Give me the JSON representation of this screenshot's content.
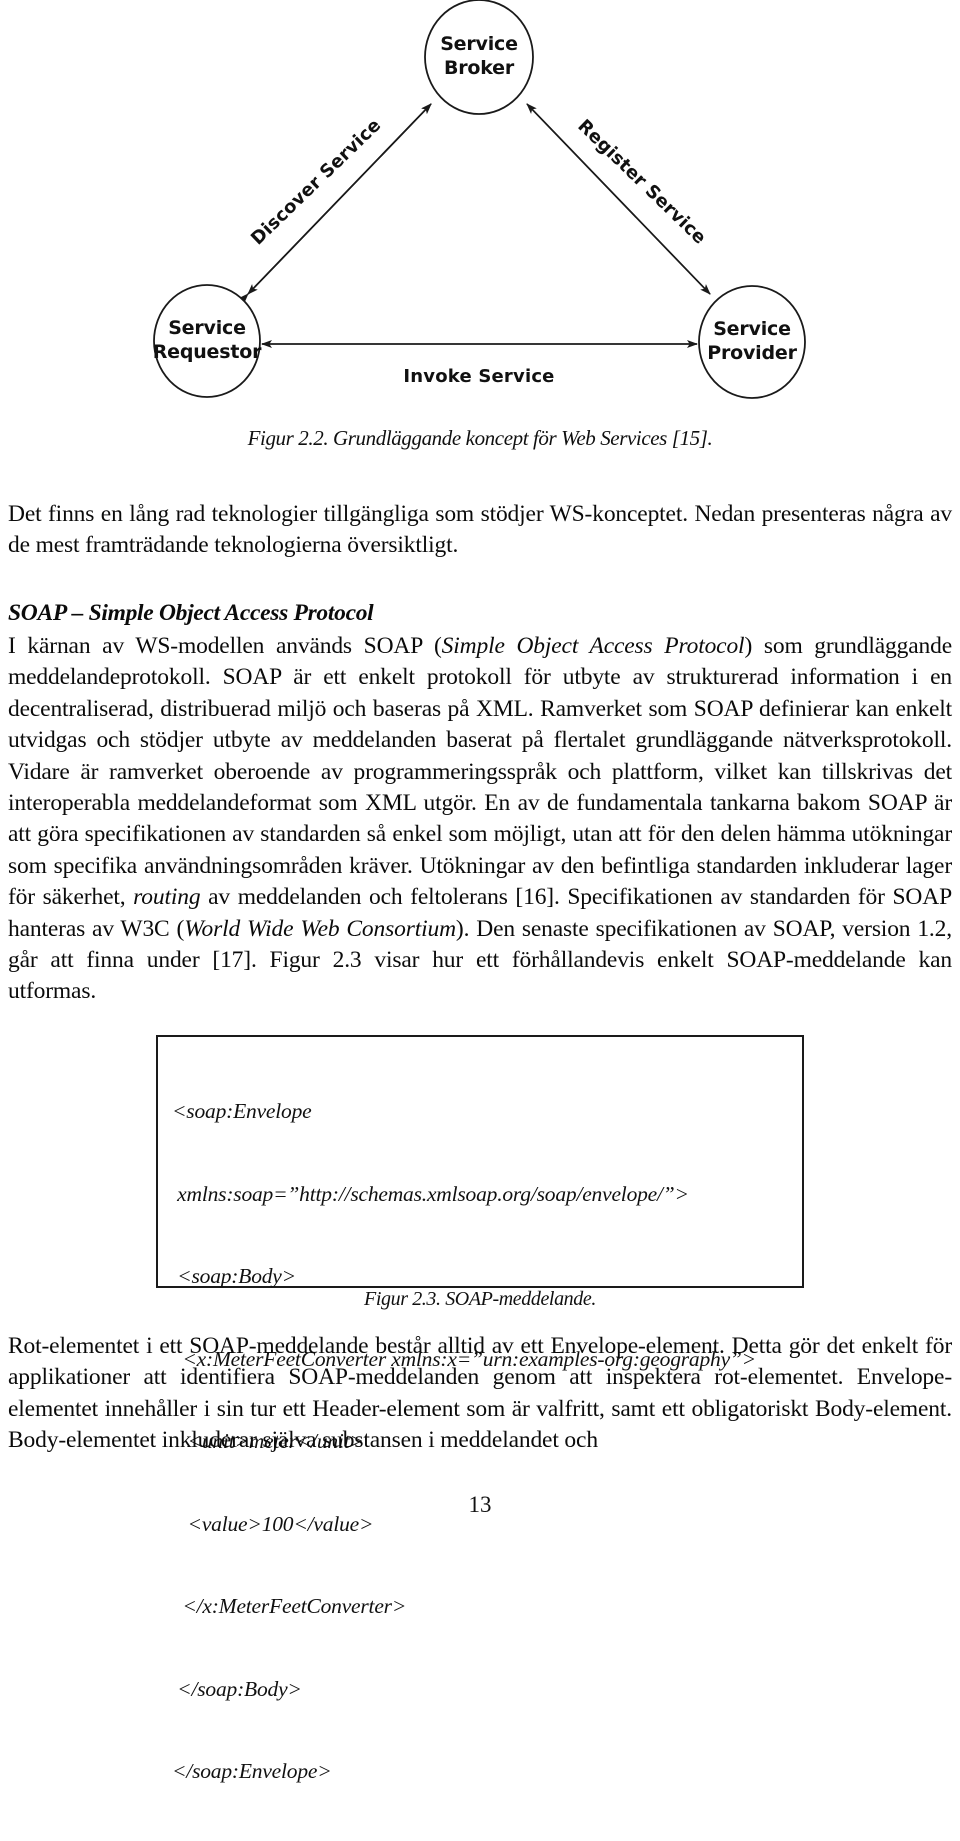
{
  "page": {
    "number": "13"
  },
  "figure_22": {
    "caption": "Figur 2.2. Grundläggande koncept för Web Services [15].",
    "nodes": [
      {
        "id": "service-broker",
        "line1": "Service",
        "line2": "Broker"
      },
      {
        "id": "service-requestor",
        "line1": "Service",
        "line2": "Requestor"
      },
      {
        "id": "service-provider",
        "line1": "Service",
        "line2": "Provider"
      }
    ],
    "edges": [
      {
        "id": "discover-service",
        "label": "Discover Service"
      },
      {
        "id": "register-service",
        "label": "Register Service"
      },
      {
        "id": "invoke-service",
        "label": "Invoke Service"
      }
    ],
    "stroke_color": "#1a1a1a"
  },
  "intro_paragraph": "Det finns en lång rad teknologier tillgängliga som stödjer WS-konceptet. Nedan presenteras några av de mest framträdande teknologierna översiktligt.",
  "soap_section": {
    "heading": "SOAP – Simple Object Access Protocol",
    "text_part_1": "I kärnan av WS-modellen används SOAP (",
    "italic_1": "Simple Object Access Protocol",
    "text_part_2": ") som grundläggande meddelandeprotokoll. SOAP är ett enkelt protokoll för utbyte av strukturerad information i en decentraliserad, distribuerad miljö och baseras på XML. Ramverket som SOAP definierar kan enkelt utvidgas och stödjer utbyte av meddelanden baserat på flertalet grundläggande nätverksprotokoll. Vidare är ramverket oberoende av programmeringsspråk och plattform, vilket kan tillskrivas det interoperabla meddelandeformat som XML utgör. En av de fundamentala tankarna bakom SOAP är att göra specifikationen av standarden så enkel som möjligt, utan att för den delen hämma utökningar som specifika användningsområden kräver. Utökningar av den befintliga standarden inkluderar lager för säkerhet, ",
    "italic_2": "routing",
    "text_part_3": " av meddelanden och feltolerans [16]. Specifikationen av standarden för SOAP hanteras av W3C (",
    "italic_3": "World Wide Web Consortium",
    "text_part_4": "). Den senaste specifikationen av SOAP, version 1.2, går att finna under [17]. Figur 2.3 visar hur ett förhållandevis enkelt SOAP-meddelande kan utformas."
  },
  "figure_23": {
    "caption": "Figur 2.3. SOAP-meddelande.",
    "code_lines": [
      "<soap:Envelope",
      " xmlns:soap=”http://schemas.xmlsoap.org/soap/envelope/”>",
      " <soap:Body>",
      "  <x:MeterFeetConverter xmlns:x=”urn:examples-org:geography”>",
      "   <unit>meter</unit>",
      "   <value>100</value>",
      "  </x:MeterFeetConverter>",
      " </soap:Body>",
      "</soap:Envelope>"
    ]
  },
  "closing_paragraph": "Rot-elementet i ett SOAP-meddelande består alltid av ett Envelope-element. Detta gör det enkelt för applikationer att identifiera SOAP-meddelanden genom att inspektera rot-elementet. Envelope-elementet innehåller i sin tur ett Header-element som är valfritt, samt ett obligatoriskt Body-element. Body-elementet inkluderar själva substansen i meddelandet och"
}
